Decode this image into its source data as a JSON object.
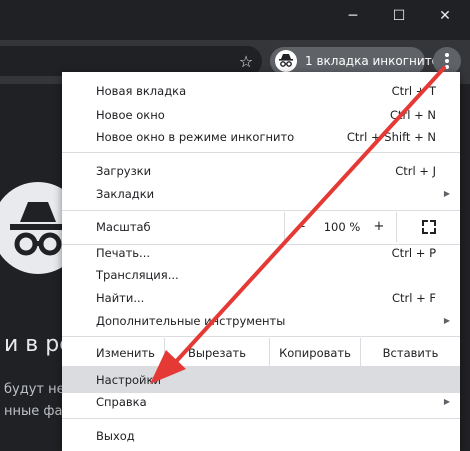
{
  "titlebar": {
    "minimize_icon": "─",
    "maximize_icon": "☐",
    "close_icon": "✕"
  },
  "toolbar": {
    "bookmark_icon": "☆",
    "incognito_label": "1 вкладка инкогнито",
    "menu_icon": "more-vert-icon"
  },
  "page": {
    "heading_fragment": "и в ре",
    "line1_fragment": "будут недо",
    "line2_fragment": "нные фай"
  },
  "menu": {
    "items_top": [
      {
        "label": "Новая вкладка",
        "shortcut": "Ctrl + T"
      },
      {
        "label": "Новое окно",
        "shortcut": "Ctrl + N"
      },
      {
        "label": "Новое окно в режиме инкогнито",
        "shortcut": "Ctrl + Shift + N"
      }
    ],
    "items_mid": [
      {
        "label": "Загрузки",
        "shortcut": "Ctrl + J"
      },
      {
        "label": "Закладки",
        "shortcut": ""
      }
    ],
    "zoom": {
      "label": "Масштаб",
      "minus": "–",
      "value": "100 %",
      "plus": "+"
    },
    "items_tools": [
      {
        "label": "Печать...",
        "shortcut": "Ctrl + P"
      },
      {
        "label": "Трансляция...",
        "shortcut": ""
      },
      {
        "label": "Найти...",
        "shortcut": "Ctrl + F"
      },
      {
        "label": "Дополнительные инструменты",
        "shortcut": ""
      }
    ],
    "edit": {
      "label": "Изменить",
      "cut": "Вырезать",
      "copy": "Копировать",
      "paste": "Вставить"
    },
    "items_settings": [
      {
        "label": "Настройки",
        "shortcut": ""
      },
      {
        "label": "Справка",
        "shortcut": ""
      }
    ],
    "exit": {
      "label": "Выход"
    }
  },
  "colors": {
    "annotation_arrow": "#e53935",
    "menu_highlight": "#dadce0",
    "frame_dark": "#202124"
  }
}
